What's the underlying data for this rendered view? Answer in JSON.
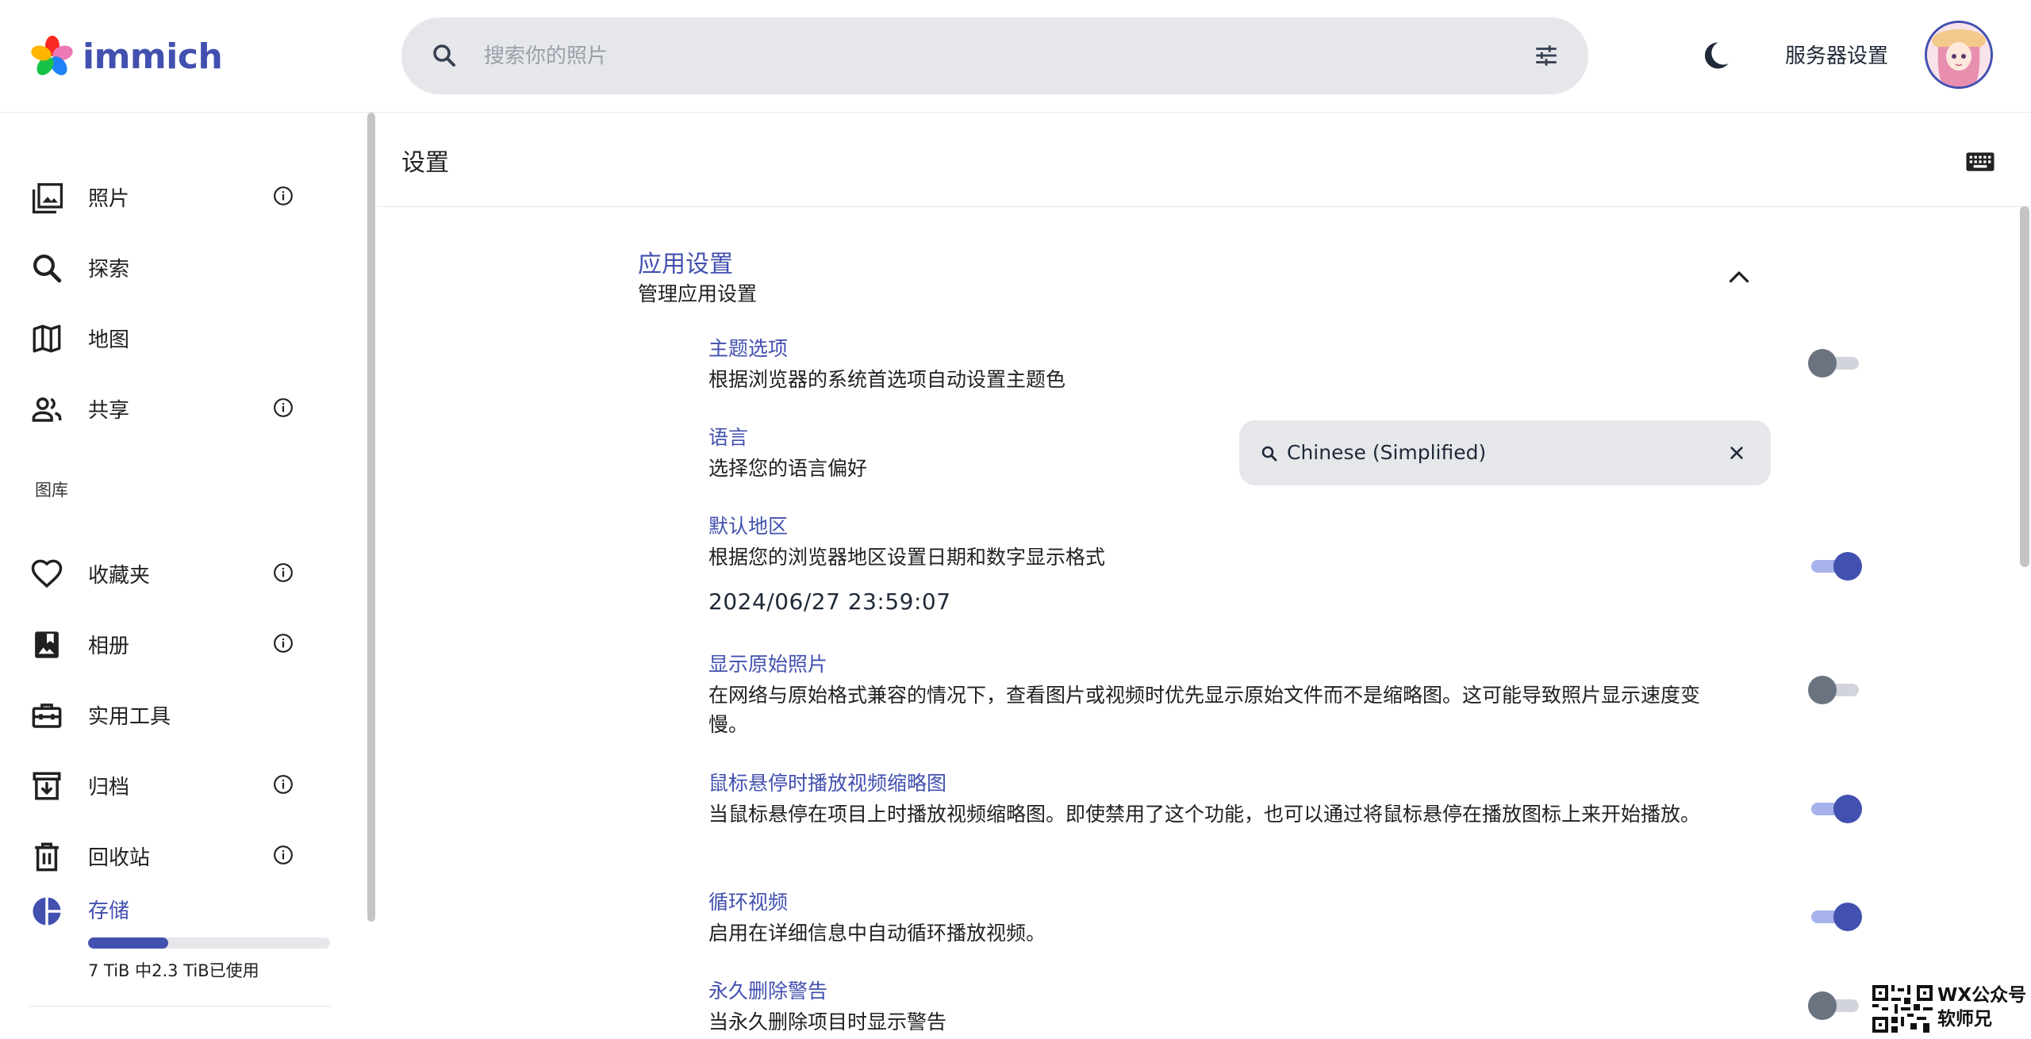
{
  "app": {
    "name": "immich"
  },
  "header": {
    "search_placeholder": "搜索你的照片",
    "server_settings_label": "服务器设置"
  },
  "sidebar": {
    "items": [
      {
        "label": "照片",
        "icon": "photos-icon"
      },
      {
        "label": "探索",
        "icon": "search-icon"
      },
      {
        "label": "地图",
        "icon": "map-icon"
      },
      {
        "label": "共享",
        "icon": "people-icon"
      }
    ],
    "library_heading": "图库",
    "library_items": [
      {
        "label": "收藏夹",
        "icon": "heart-icon"
      },
      {
        "label": "相册",
        "icon": "album-icon"
      },
      {
        "label": "实用工具",
        "icon": "toolbox-icon"
      },
      {
        "label": "归档",
        "icon": "archive-icon"
      },
      {
        "label": "回收站",
        "icon": "trash-icon"
      }
    ],
    "storage": {
      "label": "存储",
      "used_text": "7 TiB 中2.3 TiB已使用",
      "used_fraction": 0.33
    }
  },
  "main": {
    "page_title": "设置",
    "section": {
      "title": "应用设置",
      "subtitle": "管理应用设置"
    },
    "settings": [
      {
        "title": "主题选项",
        "description": "根据浏览器的系统首选项自动设置主题色",
        "enabled": false
      },
      {
        "title": "语言",
        "description": "选择您的语言偏好",
        "value": "Chinese (Simplified)"
      },
      {
        "title": "默认地区",
        "description": "根据您的浏览器地区设置日期和数字显示格式",
        "enabled": true,
        "preview": "2024/06/27 23:59:07"
      },
      {
        "title": "显示原始照片",
        "description": "在网络与原始格式兼容的情况下，查看图片或视频时优先显示原始文件而不是缩略图。这可能导致照片显示速度变慢。",
        "enabled": false
      },
      {
        "title": "鼠标悬停时播放视频缩略图",
        "description": "当鼠标悬停在项目上时播放视频缩略图。即使禁用了这个功能，也可以通过将鼠标悬停在播放图标上来开始播放。",
        "enabled": true
      },
      {
        "title": "循环视频",
        "description": "启用在详细信息中自动循环播放视频。",
        "enabled": true
      },
      {
        "title": "永久删除警告",
        "description": "当永久删除项目时显示警告",
        "enabled": false
      }
    ]
  },
  "watermark": {
    "line1": "WX公众号",
    "line2": "软师兄"
  },
  "colors": {
    "accent": "#4250af",
    "toggle_on_track": "#a7b1ea",
    "toggle_off_knob": "#6b7280"
  }
}
